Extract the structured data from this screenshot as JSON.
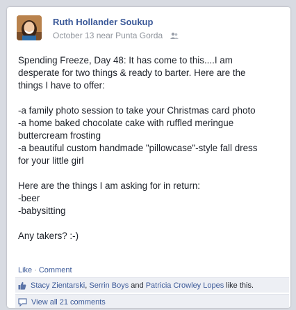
{
  "post": {
    "author": "Ruth Hollander Soukup",
    "date": "October 13",
    "location_prefix": "near",
    "location": "Punta Gorda",
    "privacy_icon": "friends-icon",
    "lines": [
      "Spending Freeze, Day 48: It has come to this....I am",
      "desperate for two things & ready to barter. Here are the",
      "things I have to offer:",
      "",
      "-a family photo session to take your Christmas card photo",
      "-a home baked chocolate cake with ruffled meringue",
      "buttercream frosting",
      "-a beautiful custom handmade \"pillowcase\"-style fall dress",
      "for your little girl",
      "",
      "Here are the things I am asking for in return:",
      "-beer",
      "-babysitting",
      "",
      "Any takers? :-)"
    ]
  },
  "actions": {
    "like": "Like",
    "separator": "·",
    "comment": "Comment"
  },
  "likes": {
    "icon": "thumbs-up-icon",
    "person1": "Stacy Zientarski",
    "sep1": ",",
    "person2": "Serrin Boys",
    "and": "and",
    "person3": "Patricia Crowley Lopes",
    "suffix": "like this."
  },
  "comments": {
    "icon": "comment-bubble-icon",
    "view_all": "View all 21 comments"
  },
  "colors": {
    "link": "#3b5998",
    "meta": "#8e939b",
    "panel": "#edeff4"
  }
}
